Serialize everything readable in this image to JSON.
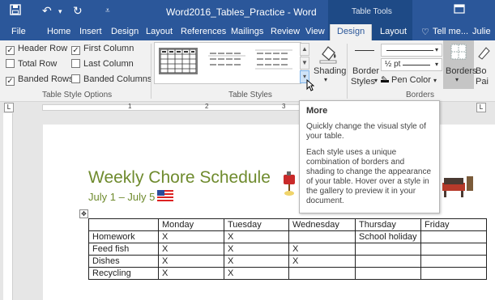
{
  "titlebar": {
    "document_title": "Word2016_Tables_Practice - Word",
    "context_header": "Table Tools",
    "icons": {
      "save": "save-icon",
      "undo": "undo-icon",
      "redo": "redo-icon",
      "customize": "customize-icon",
      "restore": "restore-icon"
    }
  },
  "tabs": [
    {
      "label": "File"
    },
    {
      "label": "Home"
    },
    {
      "label": "Insert"
    },
    {
      "label": "Design"
    },
    {
      "label": "Layout"
    },
    {
      "label": "References"
    },
    {
      "label": "Mailings"
    },
    {
      "label": "Review"
    },
    {
      "label": "View"
    },
    {
      "label": "Design"
    },
    {
      "label": "Layout"
    }
  ],
  "tell_me": "Tell me...",
  "user": "Julie",
  "style_options": {
    "items": [
      {
        "label": "Header Row",
        "checked": true
      },
      {
        "label": "First Column",
        "checked": true
      },
      {
        "label": "Total Row",
        "checked": false
      },
      {
        "label": "Last Column",
        "checked": false
      },
      {
        "label": "Banded Rows",
        "checked": true
      },
      {
        "label": "Banded Columns",
        "checked": false
      }
    ],
    "group_label": "Table Style Options"
  },
  "table_styles": {
    "group_label": "Table Styles",
    "shading_label": "Shading"
  },
  "borders": {
    "border_styles_label_1": "Border",
    "border_styles_label_2": "Styles",
    "weight": "½ pt",
    "pen_color": "Pen Color",
    "borders_label": "Borders",
    "border_painter_1": "Bo",
    "border_painter_2": "Pai",
    "group_label": "Borders"
  },
  "ruler": {
    "marks": [
      "1",
      "2",
      "3"
    ]
  },
  "document": {
    "heading": "Weekly Chore Schedule",
    "subheading": "July 1 – July 5",
    "table": [
      [
        "",
        "Monday",
        "Tuesday",
        "Wednesday",
        "Thursday",
        "Friday"
      ],
      [
        "Homework",
        "X",
        "X",
        "",
        "School holiday",
        ""
      ],
      [
        "Feed fish",
        "X",
        "X",
        "X",
        "",
        ""
      ],
      [
        "Dishes",
        "X",
        "X",
        "X",
        "",
        ""
      ],
      [
        "Recycling",
        "X",
        "X",
        "",
        "",
        ""
      ]
    ]
  },
  "tooltip": {
    "title": "More",
    "line1": "Quickly change the visual style of your table.",
    "line2": "Each style uses a unique combination of borders and shading to change the appearance of your table. Hover over a style in the gallery to preview it in your document."
  },
  "colors": {
    "word_blue": "#2b579a",
    "heading_green": "#6f8b2e"
  }
}
